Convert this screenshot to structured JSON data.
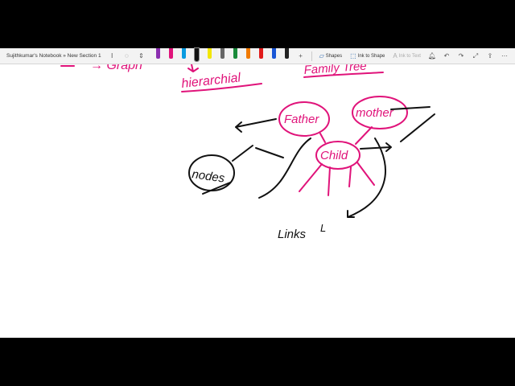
{
  "window": {
    "title": "Sujithkumar's Notebook » New Section 1"
  },
  "toolbar": {
    "undo_icon": "undo-icon",
    "lasso_icon": "lasso-select-icon",
    "add_space_icon": "add-space-icon",
    "pens": [
      {
        "color": "#8b2fb0",
        "name": "pen-purple"
      },
      {
        "color": "#e0137a",
        "name": "pen-magenta"
      },
      {
        "color": "#0a9be0",
        "name": "pen-cyan"
      },
      {
        "color": "#111111",
        "name": "pen-black",
        "selected": true
      },
      {
        "color": "#f2e600",
        "name": "pen-yellow-highlighter"
      },
      {
        "color": "#666666",
        "name": "pen-gray"
      },
      {
        "color": "#1a8a3a",
        "name": "pen-green"
      },
      {
        "color": "#f07a00",
        "name": "pen-orange"
      },
      {
        "color": "#e01a1a",
        "name": "pen-red"
      },
      {
        "color": "#1a56d6",
        "name": "pen-blue"
      },
      {
        "color": "#222222",
        "name": "pen-dark"
      }
    ],
    "add_pen": "+",
    "shapes_label": "Shapes",
    "ink_to_shape_label": "Ink to Shape",
    "ink_to_text_label": "Ink to Text"
  },
  "canvas": {
    "ink_topleft": "→ Graph",
    "ink_hierarchical": "hierarchial",
    "ink_family_tree": "Family Tree",
    "ink_father": "Father",
    "ink_mother": "mother",
    "ink_child": "Child",
    "ink_nodes": "nodes",
    "ink_links": "Links",
    "ink_links_tail": "L"
  },
  "colors": {
    "ink_magenta": "#e0137a",
    "ink_black": "#111111"
  }
}
